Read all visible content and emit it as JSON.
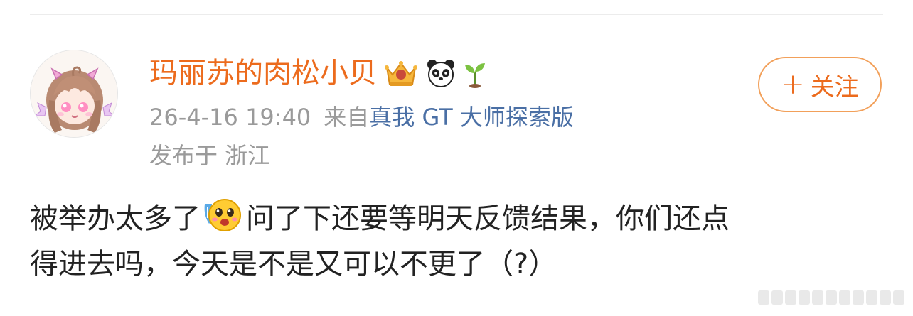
{
  "post": {
    "author": {
      "name": "玛丽苏的肉松小贝",
      "badges": [
        "crown-badge-icon",
        "panda-icon",
        "sprout-icon"
      ]
    },
    "meta": {
      "time": "26-4-16 19:40",
      "source_prefix": "来自",
      "source": "真我 GT 大师探索版",
      "location": "发布于 浙江"
    },
    "follow_button": {
      "plus": "+",
      "label": "关注"
    },
    "content": {
      "line1_part1": "被举办太多了",
      "emoji": "shocked-face-emoji",
      "line1_part2": "问了下还要等明天反馈结果，你们还点",
      "line2": "得进去吗，今天是不是又可以不更了（?）"
    }
  },
  "colors": {
    "accent": "#ec6b1d",
    "link": "#4a6fa5",
    "meta_text": "#9a9a9a",
    "body_text": "#222222"
  }
}
